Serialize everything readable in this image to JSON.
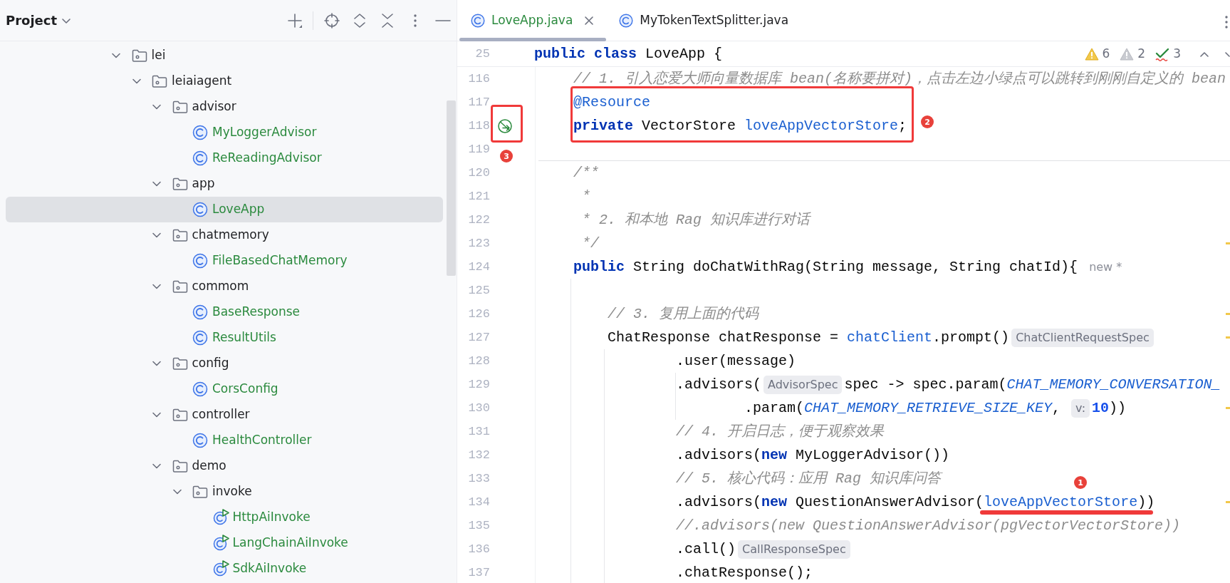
{
  "project_panel": {
    "title": "Project",
    "tree": [
      {
        "label": "lei",
        "kind": "folder",
        "expanded": true,
        "selected": false,
        "children": [
          {
            "label": "leiaiagent",
            "kind": "folder",
            "expanded": true,
            "selected": false,
            "children": [
              {
                "label": "advisor",
                "kind": "folder",
                "expanded": true,
                "selected": false,
                "children": [
                  {
                    "label": "MyLoggerAdvisor",
                    "kind": "class",
                    "added": true,
                    "selected": false
                  },
                  {
                    "label": "ReReadingAdvisor",
                    "kind": "class",
                    "added": true,
                    "selected": false
                  }
                ]
              },
              {
                "label": "app",
                "kind": "folder",
                "expanded": true,
                "selected": false,
                "children": [
                  {
                    "label": "LoveApp",
                    "kind": "class",
                    "added": true,
                    "selected": true
                  }
                ]
              },
              {
                "label": "chatmemory",
                "kind": "folder",
                "expanded": true,
                "selected": false,
                "children": [
                  {
                    "label": "FileBasedChatMemory",
                    "kind": "class",
                    "added": true,
                    "selected": false
                  }
                ]
              },
              {
                "label": "commom",
                "kind": "folder",
                "expanded": true,
                "selected": false,
                "children": [
                  {
                    "label": "BaseResponse",
                    "kind": "class",
                    "added": true,
                    "selected": false
                  },
                  {
                    "label": "ResultUtils",
                    "kind": "class",
                    "added": true,
                    "selected": false
                  }
                ]
              },
              {
                "label": "config",
                "kind": "folder",
                "expanded": true,
                "selected": false,
                "children": [
                  {
                    "label": "CorsConfig",
                    "kind": "class",
                    "added": true,
                    "selected": false
                  }
                ]
              },
              {
                "label": "controller",
                "kind": "folder",
                "expanded": true,
                "selected": false,
                "children": [
                  {
                    "label": "HealthController",
                    "kind": "class",
                    "added": true,
                    "selected": false
                  }
                ]
              },
              {
                "label": "demo",
                "kind": "folder",
                "expanded": true,
                "selected": false,
                "children": [
                  {
                    "label": "invoke",
                    "kind": "folder",
                    "expanded": true,
                    "selected": false,
                    "children": [
                      {
                        "label": "HttpAiInvoke",
                        "kind": "runnable",
                        "added": true,
                        "selected": false
                      },
                      {
                        "label": "LangChainAiInvoke",
                        "kind": "runnable",
                        "added": true,
                        "selected": false
                      },
                      {
                        "label": "SdkAiInvoke",
                        "kind": "runnable",
                        "added": true,
                        "selected": false
                      }
                    ]
                  }
                ]
              }
            ]
          }
        ]
      }
    ]
  },
  "editor": {
    "tabs": [
      {
        "label": "LoveApp.java",
        "selected": true,
        "added": true
      },
      {
        "label": "MyTokenTextSplitter.java",
        "selected": false,
        "added": false
      }
    ],
    "inspections": [
      {
        "kind": "warning",
        "count": "6"
      },
      {
        "kind": "weak-warning",
        "count": "2"
      },
      {
        "kind": "typo",
        "count": "3"
      }
    ],
    "sticky_line": {
      "number": "25",
      "segments": [
        {
          "kind": "keyword",
          "text": "public class"
        },
        {
          "kind": "plain",
          "text": " LoveApp {"
        }
      ]
    },
    "lines": [
      {
        "number": "116",
        "warning_mark": false,
        "segments": [
          {
            "kind": "comment",
            "text": "    // 1. 引入恋爱大师向量数据库 bean(名称要拼对)，点击左边小绿点可以跳转到刚刚自定义的 bean"
          }
        ]
      },
      {
        "number": "117",
        "warning_mark": false,
        "segments": [
          {
            "kind": "annotation",
            "text": "    @Resource"
          }
        ]
      },
      {
        "number": "118",
        "warning_mark": false,
        "gutter_marker": true,
        "segments": [
          {
            "kind": "keyword",
            "text": "    private"
          },
          {
            "kind": "plain",
            "text": " VectorStore "
          },
          {
            "kind": "field",
            "text": "loveAppVectorStore"
          },
          {
            "kind": "plain",
            "text": ";"
          }
        ]
      },
      {
        "number": "119",
        "warning_mark": false,
        "method_separator": true
      },
      {
        "number": "120",
        "warning_mark": false,
        "segments": [
          {
            "kind": "doc",
            "text": "    /**"
          }
        ]
      },
      {
        "number": "121",
        "warning_mark": false,
        "segments": [
          {
            "kind": "doc",
            "text": "     *"
          }
        ]
      },
      {
        "number": "122",
        "warning_mark": false,
        "segments": [
          {
            "kind": "doc",
            "text": "     * 2. 和本地 Rag 知识库进行对话"
          }
        ]
      },
      {
        "number": "123",
        "warning_mark": true,
        "segments": [
          {
            "kind": "doc",
            "text": "     */"
          }
        ]
      },
      {
        "number": "124",
        "warning_mark": false,
        "segments": [
          {
            "kind": "keyword",
            "text": "    public"
          },
          {
            "kind": "plain",
            "text": " String doChatWithRag(String message, String chatId){"
          },
          {
            "kind": "vcs",
            "text": "new *"
          }
        ]
      },
      {
        "number": "125",
        "warning_mark": false
      },
      {
        "number": "126",
        "warning_mark": true,
        "segments": [
          {
            "kind": "comment",
            "text": "        // 3. 复用上面的代码"
          }
        ]
      },
      {
        "number": "127",
        "warning_mark": true,
        "segments": [
          {
            "kind": "plain",
            "text": "        ChatResponse chatResponse = "
          },
          {
            "kind": "field",
            "text": "chatClient"
          },
          {
            "kind": "plain",
            "text": ".prompt()"
          },
          {
            "kind": "hint",
            "text": "ChatClientRequestSpec"
          }
        ]
      },
      {
        "number": "128",
        "warning_mark": false,
        "segments": [
          {
            "kind": "plain",
            "text": "                .user(message)"
          }
        ]
      },
      {
        "number": "129",
        "warning_mark": false,
        "segments": [
          {
            "kind": "plain",
            "text": "                .advisors("
          },
          {
            "kind": "hint",
            "text": "AdvisorSpec"
          },
          {
            "kind": "plain",
            "text": "spec -> spec.param("
          },
          {
            "kind": "constant",
            "text": "CHAT_MEMORY_CONVERSATION_"
          }
        ]
      },
      {
        "number": "130",
        "warning_mark": true,
        "segments": [
          {
            "kind": "plain",
            "text": "                        .param("
          },
          {
            "kind": "constant",
            "text": "CHAT_MEMORY_RETRIEVE_SIZE_KEY"
          },
          {
            "kind": "plain",
            "text": ", "
          },
          {
            "kind": "hint",
            "text": "v:"
          },
          {
            "kind": "number",
            "text": "10"
          },
          {
            "kind": "plain",
            "text": "))"
          }
        ]
      },
      {
        "number": "131",
        "warning_mark": false,
        "segments": [
          {
            "kind": "comment",
            "text": "                // 4. 开启日志，便于观察效果"
          }
        ]
      },
      {
        "number": "132",
        "warning_mark": false,
        "segments": [
          {
            "kind": "plain",
            "text": "                .advisors("
          },
          {
            "kind": "keyword",
            "text": "new"
          },
          {
            "kind": "plain",
            "text": " MyLoggerAdvisor())"
          }
        ]
      },
      {
        "number": "133",
        "warning_mark": false,
        "segments": [
          {
            "kind": "comment",
            "text": "                // 5. 核心代码：应用 Rag 知识库问答"
          }
        ]
      },
      {
        "number": "134",
        "warning_mark": true,
        "segments": [
          {
            "kind": "plain",
            "text": "                .advisors("
          },
          {
            "kind": "keyword",
            "text": "new"
          },
          {
            "kind": "plain",
            "text": " QuestionAnswerAdvisor("
          },
          {
            "kind": "field",
            "text": "loveAppVectorStore"
          },
          {
            "kind": "plain",
            "text": "))"
          }
        ]
      },
      {
        "number": "135",
        "warning_mark": false,
        "segments": [
          {
            "kind": "comment",
            "text": "                //.advisors(new QuestionAnswerAdvisor(pgVectorVectorStore))"
          }
        ]
      },
      {
        "number": "136",
        "warning_mark": false,
        "segments": [
          {
            "kind": "plain",
            "text": "                .call()"
          },
          {
            "kind": "hint",
            "text": "CallResponseSpec"
          }
        ]
      },
      {
        "number": "137",
        "warning_mark": false,
        "segments": [
          {
            "kind": "plain",
            "text": "                .chatResponse();"
          }
        ]
      }
    ]
  },
  "callouts": [
    {
      "number": "1",
      "kind": "underline"
    },
    {
      "number": "2",
      "kind": "box"
    },
    {
      "number": "3",
      "kind": "box"
    }
  ]
}
